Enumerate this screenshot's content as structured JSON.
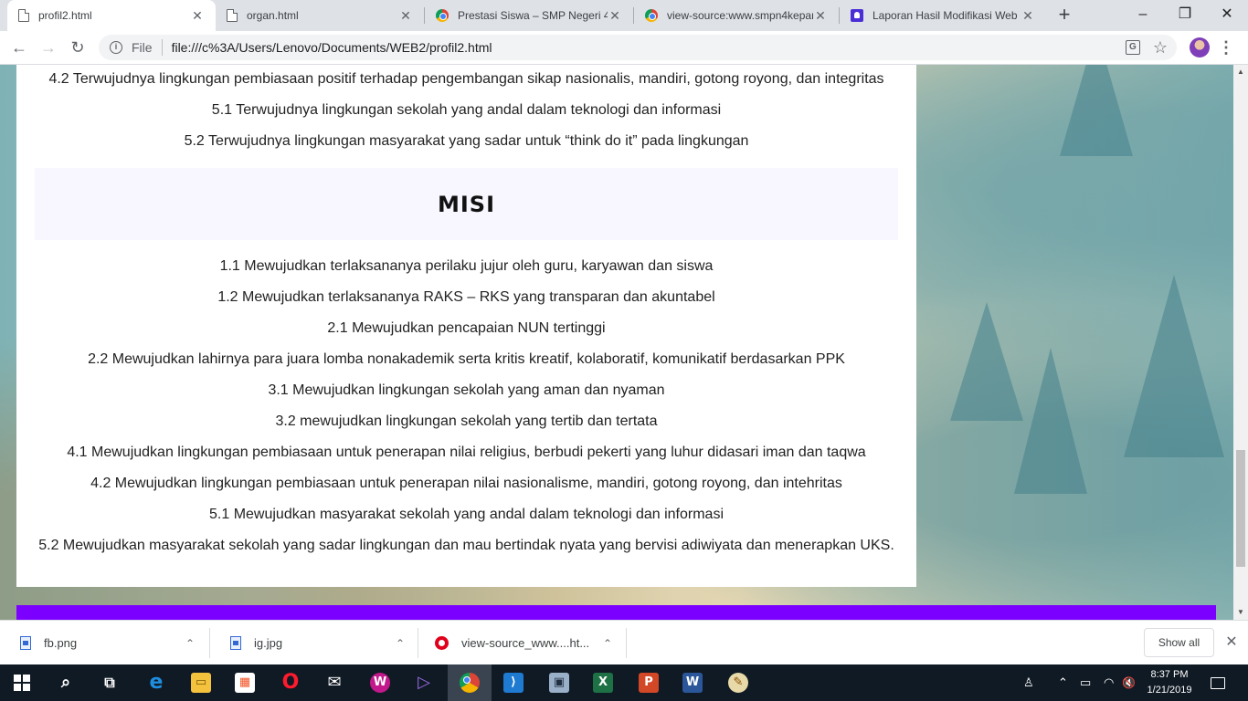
{
  "browser": {
    "tabs": [
      {
        "title": "profil2.html",
        "favicon": "document-icon",
        "active": true
      },
      {
        "title": "organ.html",
        "favicon": "document-icon",
        "active": false
      },
      {
        "title": "Prestasi Siswa – SMP Negeri 4",
        "favicon": "chrome-icon",
        "active": false
      },
      {
        "title": "view-source:www.smpn4kepan",
        "favicon": "chrome-icon",
        "active": false
      },
      {
        "title": "Laporan Hasil Modifikasi Web",
        "favicon": "blogger-icon",
        "active": false
      }
    ],
    "new_tab": "+",
    "window_controls": {
      "minimize": "–",
      "maximize": "❐",
      "close": "✕"
    },
    "toolbar": {
      "back": "←",
      "forward": "→",
      "reload": "↻",
      "info_icon": "i",
      "scheme_label": "File",
      "url": "file:///c%3A/Users/Lenovo/Documents/WEB2/profil2.html",
      "translate_icon": "G",
      "bookmark_icon": "☆",
      "menu_icon": "⋮"
    }
  },
  "page": {
    "visi_lines": [
      "4.2 Terwujudnya lingkungan pembiasaan positif terhadap pengembangan sikap nasionalis, mandiri, gotong royong, dan integritas",
      "5.1 Terwujudnya lingkungan sekolah yang andal dalam teknologi dan informasi",
      "5.2 Terwujudnya lingkungan masyarakat yang sadar untuk “think do it” pada lingkungan"
    ],
    "misi_heading": "MISI",
    "misi_lines": [
      "1.1 Mewujudkan terlaksananya perilaku jujur oleh guru, karyawan dan siswa",
      "1.2 Mewujudkan terlaksananya RAKS – RKS yang transparan dan akuntabel",
      "2.1 Mewujudkan pencapaian NUN tertinggi",
      "2.2 Mewujudkan lahirnya para juara lomba nonakademik serta kritis kreatif, kolaboratif, komunikatif berdasarkan PPK",
      "3.1 Mewujudkan lingkungan sekolah yang aman dan nyaman",
      "3.2 mewujudkan lingkungan sekolah yang tertib dan tertata",
      "4.1 Mewujudkan lingkungan pembiasaan untuk penerapan nilai religius, berbudi pekerti yang luhur didasari iman dan taqwa",
      "4.2 Mewujudkan lingkungan pembiasaan untuk penerapan nilai nasionalisme, mandiri, gotong royong, dan intehritas",
      "5.1 Mewujudkan masyarakat sekolah yang andal dalam teknologi dan informasi",
      "5.2 Mewujudkan masyarakat sekolah yang sadar lingkungan dan mau bertindak nyata yang bervisi adiwiyata dan menerapkan UKS."
    ],
    "colors": {
      "misi_bg": "#f8f6ff",
      "footer_bar": "#7b00ff",
      "content_bg": "#ffffff"
    }
  },
  "downloads": {
    "items": [
      {
        "name": "fb.png",
        "icon": "image-file-icon"
      },
      {
        "name": "ig.jpg",
        "icon": "image-file-icon"
      },
      {
        "name": "view-source_www....ht...",
        "icon": "opera-icon"
      }
    ],
    "chevron": "⌃",
    "show_all": "Show all",
    "close": "✕"
  },
  "taskbar": {
    "apps": [
      {
        "name": "search",
        "glyph": "⌕"
      },
      {
        "name": "task-view",
        "glyph": "⧉"
      },
      {
        "name": "edge",
        "glyph": "e"
      },
      {
        "name": "file-explorer",
        "glyph": "▭"
      },
      {
        "name": "store",
        "glyph": "▦"
      },
      {
        "name": "opera",
        "glyph": "O"
      },
      {
        "name": "mail",
        "glyph": "✉"
      },
      {
        "name": "wamp",
        "glyph": "W"
      },
      {
        "name": "visual-studio",
        "glyph": "▷"
      },
      {
        "name": "chrome",
        "glyph": "●"
      },
      {
        "name": "vs-code",
        "glyph": "⟩"
      },
      {
        "name": "network-monitor",
        "glyph": "▣"
      },
      {
        "name": "excel",
        "glyph": "X"
      },
      {
        "name": "powerpoint",
        "glyph": "P"
      },
      {
        "name": "word",
        "glyph": "W"
      },
      {
        "name": "paint",
        "glyph": "✎"
      }
    ],
    "tray": {
      "people": "♙",
      "chevron": "⌃",
      "battery": "▭",
      "wifi": "◠",
      "volume": "🔇"
    },
    "time": "8:37 PM",
    "date": "1/21/2019"
  }
}
